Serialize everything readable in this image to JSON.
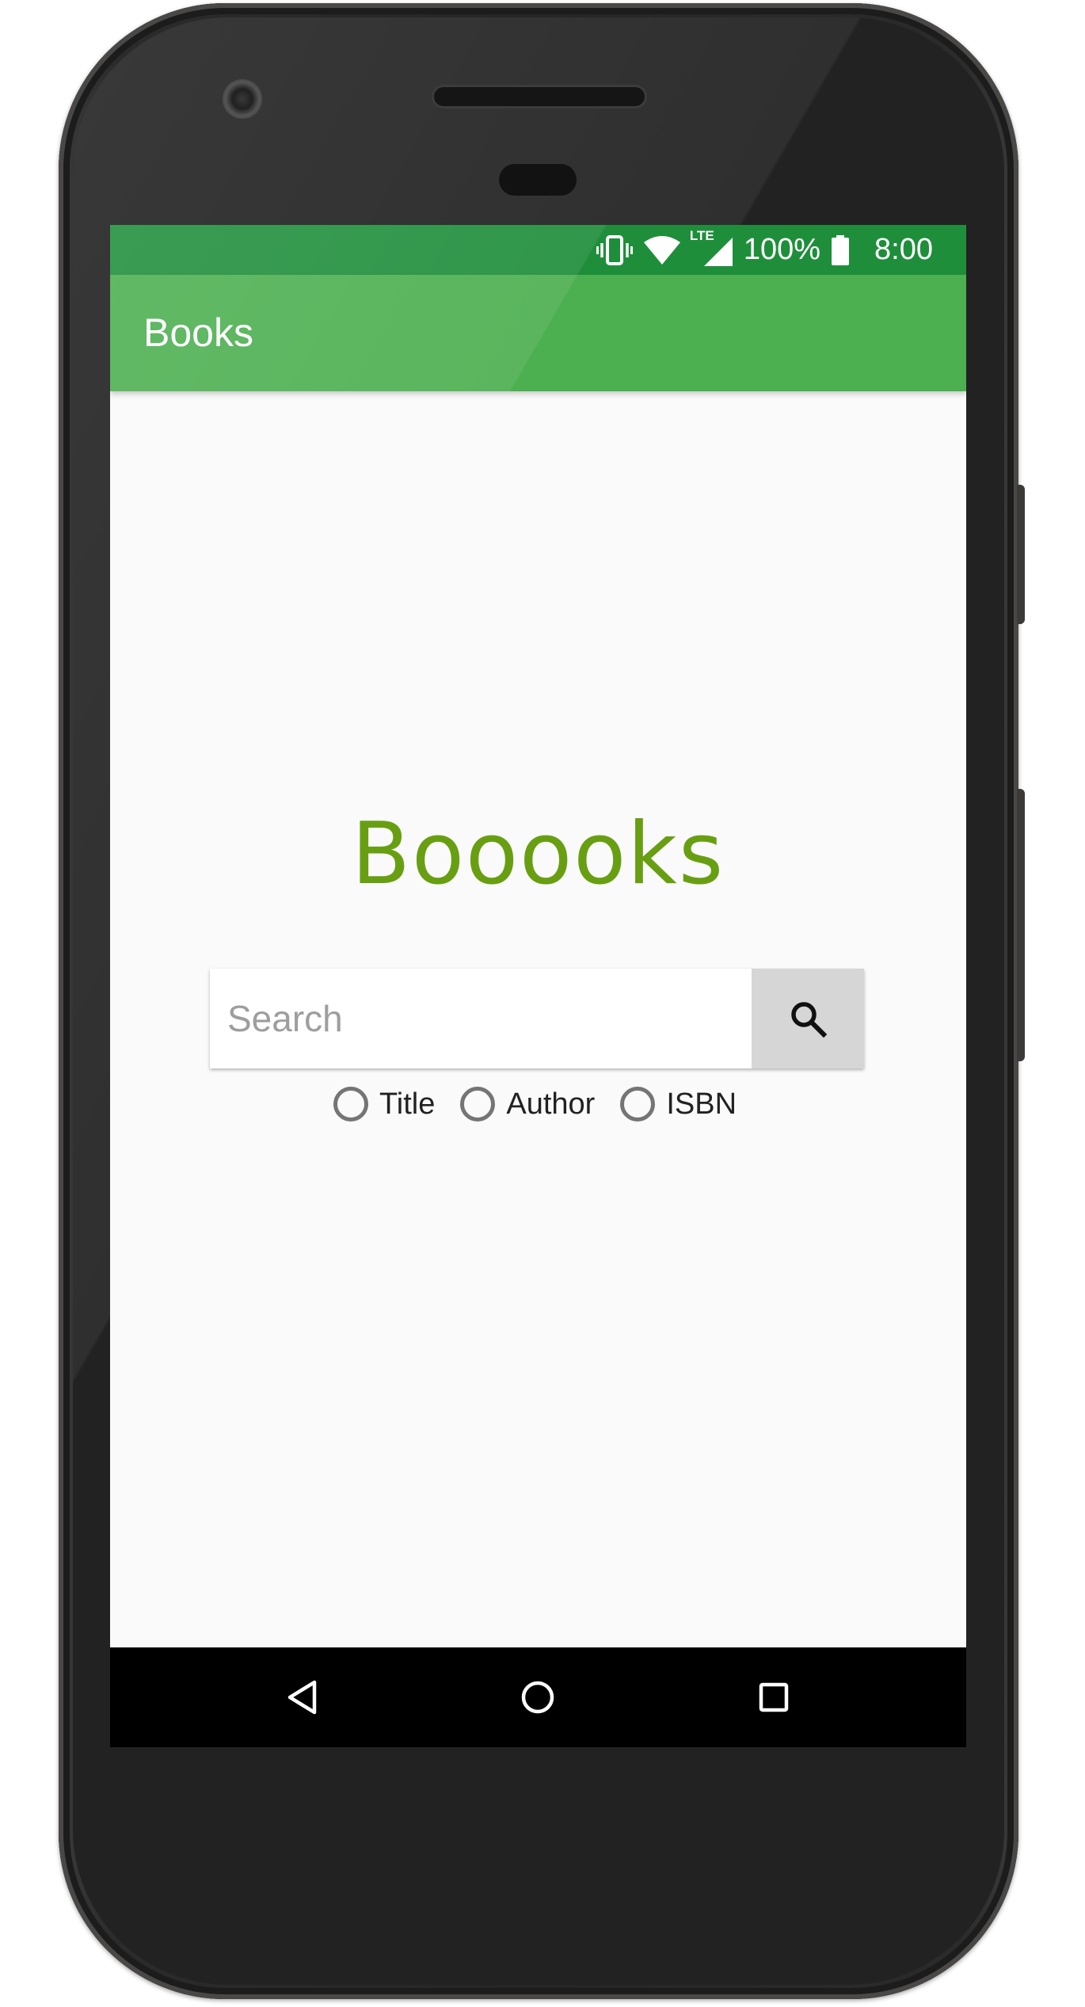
{
  "status_bar": {
    "battery_percent": "100%",
    "time": "8:00",
    "network_label": "LTE",
    "icons": [
      "vibrate-icon",
      "wifi-icon",
      "lte-signal-icon",
      "battery-icon"
    ]
  },
  "app_bar": {
    "title": "Books"
  },
  "main": {
    "brand_title": "Booooks",
    "search": {
      "placeholder": "Search",
      "value": "",
      "button_icon": "search-icon"
    },
    "search_options": [
      {
        "label": "Title",
        "selected": false
      },
      {
        "label": "Author",
        "selected": false
      },
      {
        "label": "ISBN",
        "selected": false
      }
    ]
  },
  "nav_bar": {
    "buttons": [
      "back-icon",
      "home-icon",
      "recents-icon"
    ]
  },
  "colors": {
    "status_bar": "#1f8e3b",
    "app_bar": "#4caf50",
    "brand_text": "#689f12",
    "screen_background": "#fafafa",
    "search_button": "#d6d6d6"
  }
}
